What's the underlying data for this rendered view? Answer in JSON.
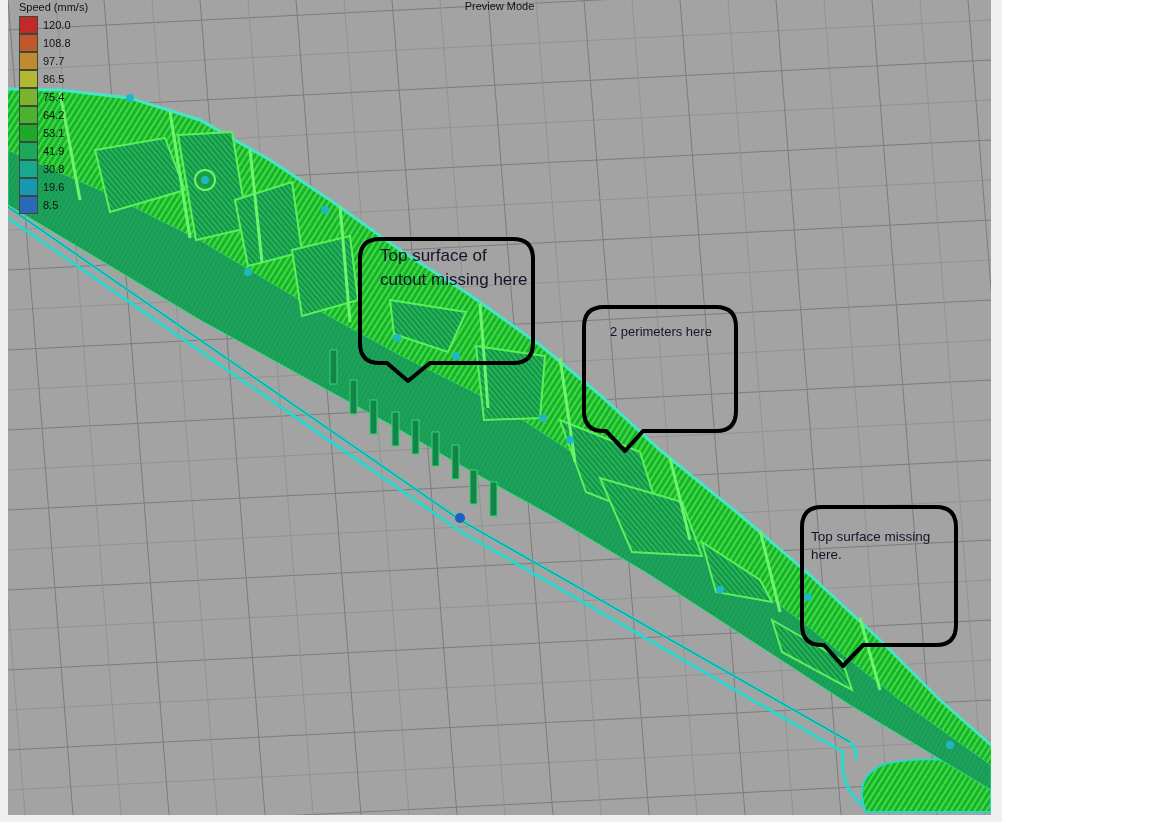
{
  "viewport": {
    "title": "Preview Mode"
  },
  "legend": {
    "title": "Speed (mm/s)",
    "items": [
      {
        "label": "120.0",
        "color": "#c22a2a"
      },
      {
        "label": "108.8",
        "color": "#c0582c"
      },
      {
        "label": "97.7",
        "color": "#c08a30"
      },
      {
        "label": "86.5",
        "color": "#b2b832"
      },
      {
        "label": "75.4",
        "color": "#7ab42e"
      },
      {
        "label": "64.2",
        "color": "#4cb030"
      },
      {
        "label": "53.1",
        "color": "#20a82a"
      },
      {
        "label": "41.9",
        "color": "#1aa85a"
      },
      {
        "label": "30.8",
        "color": "#18a88e"
      },
      {
        "label": "19.6",
        "color": "#1898b0"
      },
      {
        "label": "8.5",
        "color": "#2a68b8"
      }
    ]
  },
  "callouts": [
    {
      "text": "Top surface of cutout missing here"
    },
    {
      "text": "2 perimeters here"
    },
    {
      "text": "Top surface missing here."
    }
  ]
}
